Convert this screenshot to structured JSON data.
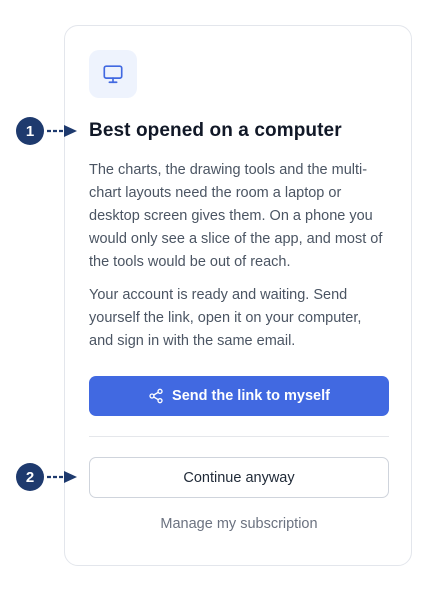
{
  "card": {
    "icon": "monitor-icon",
    "title": "Best opened on a computer",
    "paragraph_1": "The charts, the drawing tools and the multi-chart layouts need the room a laptop or desktop screen gives them. On a phone you would only see a slice of the app, and most of the tools would be out of reach.",
    "paragraph_2": "Your account is ready and waiting. Send yourself the link, open it on your computer, and sign in with the same email.",
    "primary_button": {
      "label": "Send the link to myself",
      "icon": "share-icon"
    },
    "secondary_button": {
      "label": "Continue anyway"
    },
    "manage_link": "Manage my subscription"
  },
  "callouts": [
    {
      "number": "1"
    },
    {
      "number": "2"
    }
  ],
  "colors": {
    "primary": "#4169e1",
    "callout": "#1e3a6e",
    "icon_tile": "#eef3fd",
    "icon_stroke": "#4169e1"
  }
}
